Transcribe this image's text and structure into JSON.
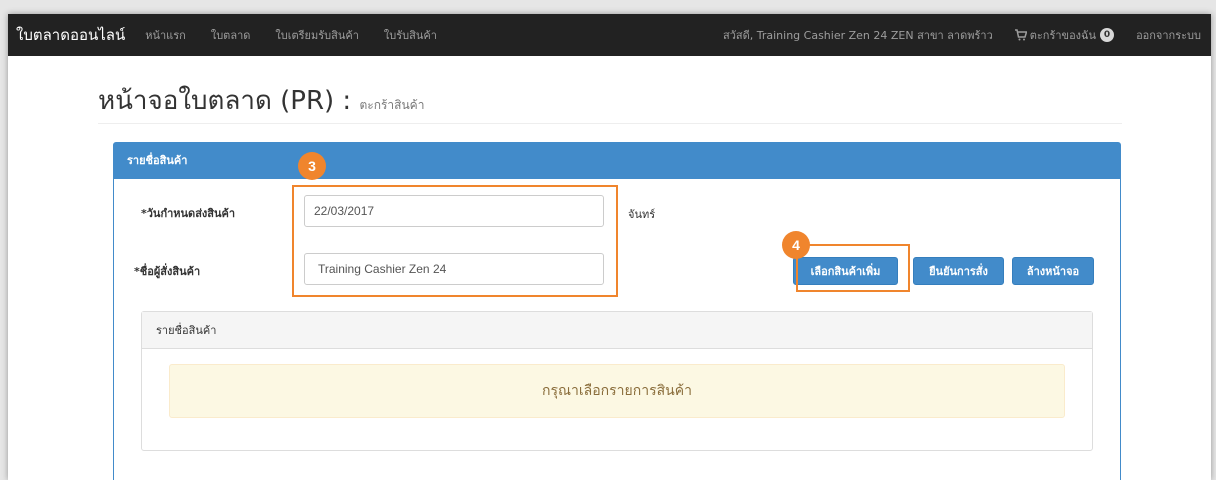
{
  "navbar": {
    "brand": "ใบตลาดออนไลน์",
    "links": [
      "หน้าแรก",
      "ใบตลาด",
      "ใบเตรียมรับสินค้า",
      "ใบรับสินค้า"
    ],
    "greeting": "สวัสดี, Training Cashier Zen 24 ZEN สาขา ลาดพร้าว",
    "cart_label": "ตะกร้าของฉัน",
    "cart_count": "0",
    "logout": "ออกจากระบบ"
  },
  "page": {
    "title": "หน้าจอใบตลาด (PR) :",
    "subtitle": "ตะกร้าสินค้า"
  },
  "panel": {
    "heading": "รายชื่อสินค้า",
    "delivery_date_label": "*วันกำหนดส่งสินค้า",
    "delivery_date_value": "22/03/2017",
    "day_name": "จันทร์",
    "orderer_label": "*ชื่อผู้สั่งสินค้า",
    "orderer_value": "Training Cashier Zen 24",
    "buttons": {
      "add_more": "เลือกสินค้าเพิ่ม",
      "confirm": "ยืนยันการสั่ง",
      "clear": "ล้างหน้าจอ"
    }
  },
  "product_list": {
    "heading": "รายชื่อสินค้า",
    "empty_message": "กรุณาเลือกรายการสินค้า"
  },
  "callouts": [
    "3",
    "4"
  ],
  "colors": {
    "navbar": "#222222",
    "primary": "#428bca",
    "callout": "#f0852d",
    "warning_bg": "#fcf8e3"
  }
}
